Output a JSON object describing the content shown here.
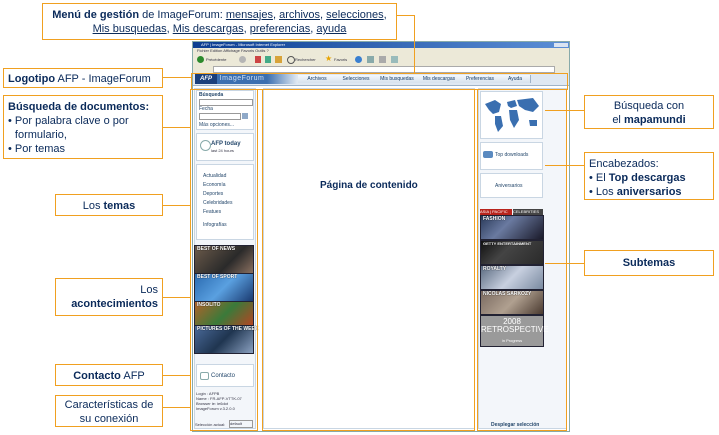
{
  "callouts": {
    "menu": {
      "b": "Menú de gestión",
      "t1": " de ImageForum: ",
      "l1": "mensajes",
      "l2": "archivos",
      "l3": "selecciones",
      "l4": "Mis busquedas",
      "l5": "Mis descargas",
      "l6": "preferencias",
      "l7": "ayuda"
    },
    "logo": {
      "b": "Logotipo",
      "t": " AFP - ImageForum"
    },
    "search": {
      "title": "Búsqueda de documentos:",
      "i1": "Por palabra clave o por formulario,",
      "i2": "Por temas"
    },
    "temas": {
      "t": "Los ",
      "b": "temas"
    },
    "events": {
      "t": "Los",
      "b": "acontecimientos"
    },
    "contact": {
      "b": "Contacto",
      "t": " AFP"
    },
    "conn": {
      "l1": "Características de",
      "l2": "su conexión"
    },
    "content": {
      "t": "Página de contenido"
    },
    "map": {
      "t1": "Búsqueda con",
      "t2": "el ",
      "b": "mapamundi"
    },
    "headers": {
      "t": "Encabezados:",
      "i1a": "El ",
      "i1b": "Top descargas",
      "i2a": "Los ",
      "i2b": "aniversarios"
    },
    "subtemas": {
      "t": "Subtemas"
    }
  },
  "browser": {
    "title": "AFP | ImageForum - Microsoft Internet Explorer",
    "menubar": "Fichier   Edition   Affichage   Favoris   Outils   ?",
    "back": "Précédente",
    "search_btn": "Rechercher",
    "fav_btn": "Favoris",
    "logo_afp": "AFP",
    "logo_if": "ImageForum",
    "tabs": [
      "Archivos",
      "Selecciones",
      "Mis busquedas",
      "Mis descargas",
      "Preferencias",
      "Ayuda"
    ]
  },
  "left": {
    "busqueda": "Búsqueda",
    "fecha": "Fecha",
    "mas": "Más opciones...",
    "afp_today": "AFP today",
    "afp_today_sub": "last 24 hours",
    "topics": [
      "Actualidad",
      "Economía",
      "Deportes",
      "Celebridades",
      "Featues",
      "Infografías"
    ],
    "events": [
      "BEST OF NEWS",
      "BEST OF SPORT",
      "INSOLITO",
      "PICTURES OF THE WEEK"
    ],
    "contacto": "Contacto",
    "conn_info": [
      "Login : AFPB",
      "Name : FR-AFP-VTTK-07",
      "Browser ie: ie6dot",
      "ImageForum v.3.2.0.0"
    ],
    "selection_label": "Selección actual:",
    "selection_value": "default"
  },
  "right": {
    "top_downloads": "Top downloads",
    "aniversarios": "Aniversarios",
    "asia_tag": "ASIA | PACIFIC",
    "celeb_tag": "CELEBRITIES",
    "subthemes": [
      "FASHION",
      "GETTY ENTERTAINMENT",
      "ROYALTY",
      "NICOLAS SARKOZY",
      "2008 RETROSPECTIVE"
    ],
    "retro_sub": "in Progress",
    "desplegar": "Desplegar selección"
  },
  "colors": {
    "accent": "#f0a020",
    "navy": "#0a2a5a"
  }
}
